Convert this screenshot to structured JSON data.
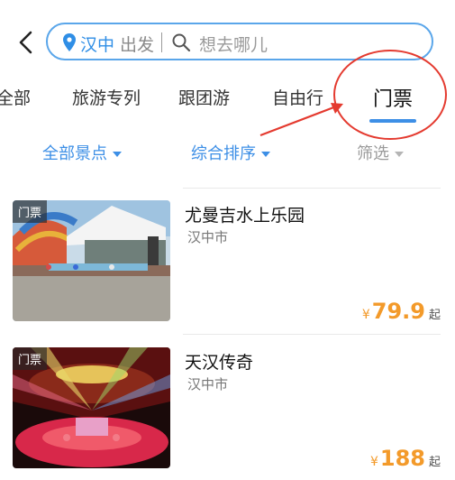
{
  "header": {
    "city": "汉中",
    "depart_label": "出发",
    "search_placeholder": "想去哪儿"
  },
  "tabs": [
    {
      "label": "全部"
    },
    {
      "label": "旅游专列"
    },
    {
      "label": "跟团游"
    },
    {
      "label": "自由行"
    },
    {
      "label": "门票",
      "active": true
    }
  ],
  "filters": [
    {
      "label": "全部景点"
    },
    {
      "label": "综合排序"
    },
    {
      "label": "筛选"
    }
  ],
  "products": [
    {
      "badge": "门票",
      "title": "尤曼吉水上乐园",
      "location": "汉中市",
      "currency": "¥",
      "price": "79.9",
      "suffix": "起"
    },
    {
      "badge": "门票",
      "title": "天汉传奇",
      "location": "汉中市",
      "currency": "¥",
      "price": "188",
      "suffix": "起"
    }
  ],
  "colors": {
    "accent": "#3d8fe6",
    "price": "#f39a2a",
    "annotation": "#e43a2f"
  }
}
